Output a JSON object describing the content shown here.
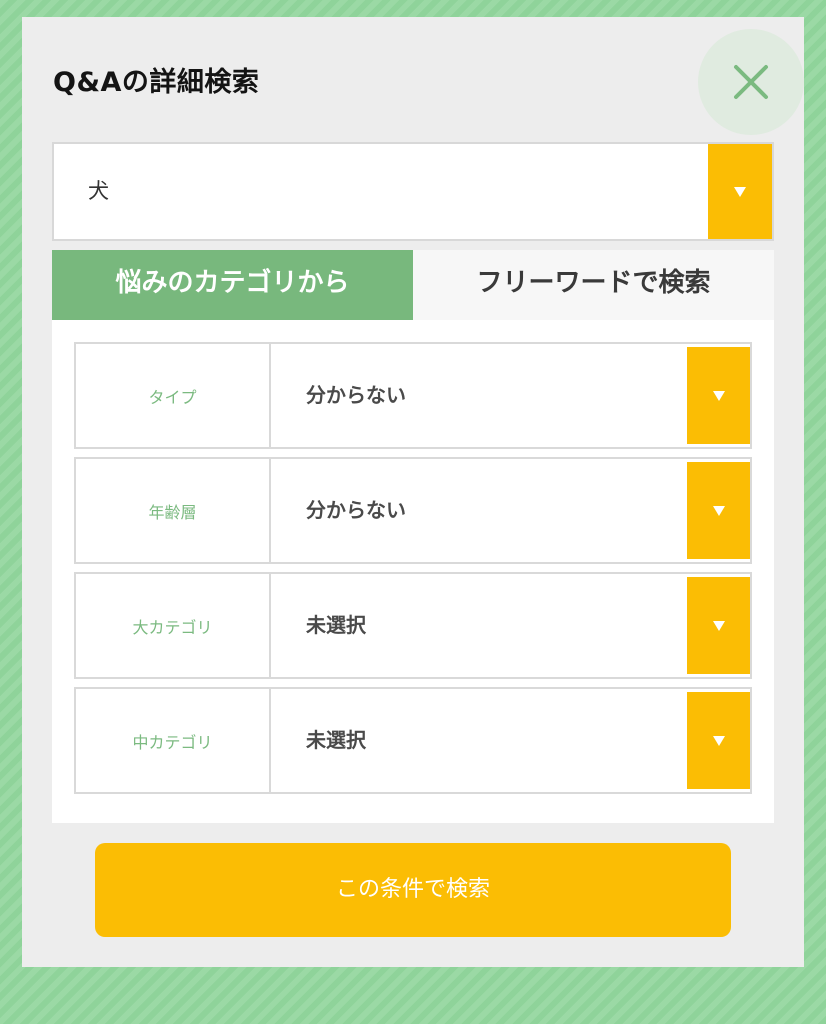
{
  "modal": {
    "title": "Q&Aの詳細検索",
    "close_icon": "close-x-icon"
  },
  "species_select": {
    "value": "犬",
    "arrow_icon": "triangle-down-icon"
  },
  "tabs": [
    {
      "label": "悩みのカテゴリから",
      "active": true
    },
    {
      "label": "フリーワードで検索",
      "active": false
    }
  ],
  "filters": [
    {
      "label": "タイプ",
      "value": "分からない"
    },
    {
      "label": "年齢層",
      "value": "分からない"
    },
    {
      "label": "大カテゴリ",
      "value": "未選択"
    },
    {
      "label": "中カテゴリ",
      "value": "未選択"
    }
  ],
  "submit_label": "この条件で検索",
  "colors": {
    "background": "#8fd39a",
    "modal_bg": "#ededed",
    "accent_green": "#78b87d",
    "accent_yellow": "#fbbd04",
    "close_circle": "#e0ebe0"
  }
}
